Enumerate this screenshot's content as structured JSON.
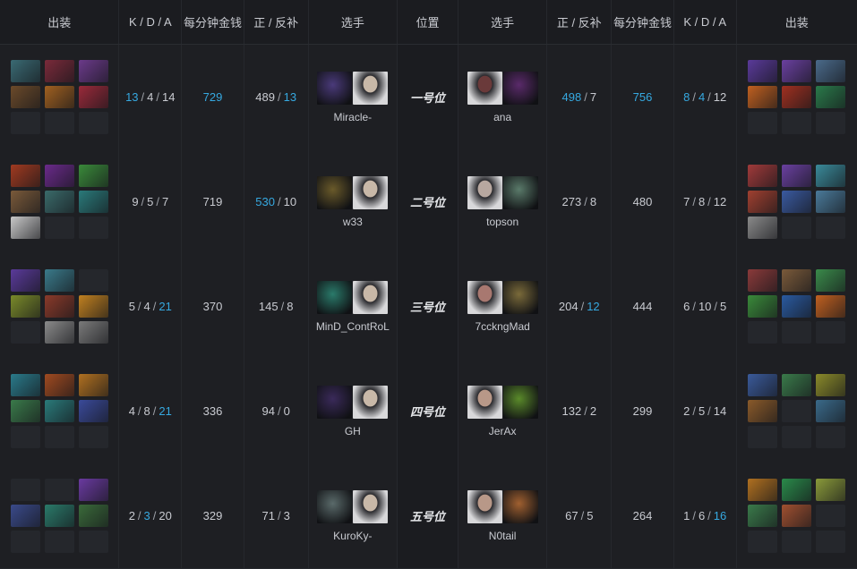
{
  "header": {
    "items_left": "出装",
    "kda_left": "K / D / A",
    "gpm_left": "每分钟金钱",
    "lh_left": "正 / 反补",
    "player_left": "选手",
    "position": "位置",
    "player_right": "选手",
    "lh_right": "正 / 反补",
    "gpm_right": "每分钟金钱",
    "kda_right": "K / D / A",
    "items_right": "出装"
  },
  "rows": [
    {
      "position": "一号位",
      "left": {
        "items": [
          "#3a6a73",
          "#7a2a3a",
          "#6b3a8a",
          "#6b4a2a",
          "#a06020",
          "#9a2a3a",
          "",
          "",
          ""
        ],
        "kills": "13",
        "deaths": "4",
        "assists": "14",
        "kills_hi": true,
        "deaths_hi": false,
        "assists_hi": false,
        "gpm": "729",
        "gpm_hi": true,
        "lh": "489",
        "dn": "13",
        "lh_hi": false,
        "dn_hi": true,
        "hero_color": "#4a3a7a",
        "photo_color": "#c8b8a8",
        "player": "Miracle-"
      },
      "right": {
        "items": [
          "#5a3a9a",
          "#6a40a0",
          "#4a6a8a",
          "#c06020",
          "#a03020",
          "#2a7a4a",
          "",
          "",
          ""
        ],
        "kills": "8",
        "deaths": "4",
        "assists": "12",
        "kills_hi": true,
        "deaths_hi": true,
        "assists_hi": false,
        "gpm": "756",
        "gpm_hi": true,
        "lh": "498",
        "dn": "7",
        "lh_hi": true,
        "dn_hi": false,
        "hero_color": "#5a2a6a",
        "photo_color": "#6a3a3a",
        "player": "ana"
      }
    },
    {
      "position": "二号位",
      "left": {
        "items": [
          "#a03a20",
          "#6a2a8a",
          "#3a8a3a",
          "#7a5a3a",
          "#3a6a6a",
          "#2a7a7a",
          "#c8c8c8",
          "",
          ""
        ],
        "kills": "9",
        "deaths": "5",
        "assists": "7",
        "kills_hi": false,
        "deaths_hi": false,
        "assists_hi": false,
        "gpm": "719",
        "gpm_hi": false,
        "lh": "530",
        "dn": "10",
        "lh_hi": true,
        "dn_hi": false,
        "hero_color": "#6a5a2a",
        "photo_color": "#c8b8a8",
        "player": "w33"
      },
      "right": {
        "items": [
          "#a03a3a",
          "#6a40a0",
          "#3a8a9a",
          "#a04030",
          "#3a5aa0",
          "#4a7a9a",
          "#8a8a8a",
          "",
          ""
        ],
        "kills": "7",
        "deaths": "8",
        "assists": "12",
        "kills_hi": false,
        "deaths_hi": false,
        "assists_hi": false,
        "gpm": "480",
        "gpm_hi": false,
        "lh": "273",
        "dn": "8",
        "lh_hi": false,
        "dn_hi": false,
        "hero_color": "#5a7a6a",
        "photo_color": "#b8a8a0",
        "player": "topson"
      }
    },
    {
      "position": "三号位",
      "left": {
        "items": [
          "#5a3a9a",
          "#3a7a8a",
          "",
          "#7a8a2a",
          "#8a3a2a",
          "#c08020",
          "",
          "#8a8a8a",
          "#7a7a7a"
        ],
        "kills": "5",
        "deaths": "4",
        "assists": "21",
        "kills_hi": false,
        "deaths_hi": false,
        "assists_hi": true,
        "gpm": "370",
        "gpm_hi": false,
        "lh": "145",
        "dn": "8",
        "lh_hi": false,
        "dn_hi": false,
        "hero_color": "#2a7a6a",
        "photo_color": "#c8b8a8",
        "player": "MinD_ContRoL"
      },
      "right": {
        "items": [
          "#8a3a3a",
          "#7a5a3a",
          "#3a8a4a",
          "#3a8a3a",
          "#2a5aa0",
          "#c06020",
          "",
          "",
          ""
        ],
        "kills": "6",
        "deaths": "10",
        "assists": "5",
        "kills_hi": false,
        "deaths_hi": false,
        "assists_hi": false,
        "gpm": "444",
        "gpm_hi": false,
        "lh": "204",
        "dn": "12",
        "lh_hi": false,
        "dn_hi": true,
        "hero_color": "#7a6a3a",
        "photo_color": "#a87870",
        "player": "7cckngMad"
      }
    },
    {
      "position": "四号位",
      "left": {
        "items": [
          "#2a7a8a",
          "#a04a20",
          "#b07020",
          "#3a7a4a",
          "#2a7a7a",
          "#3a4a9a",
          "",
          "",
          ""
        ],
        "kills": "4",
        "deaths": "8",
        "assists": "21",
        "kills_hi": false,
        "deaths_hi": false,
        "assists_hi": true,
        "gpm": "336",
        "gpm_hi": false,
        "lh": "94",
        "dn": "0",
        "lh_hi": false,
        "dn_hi": false,
        "hero_color": "#3a2a5a",
        "photo_color": "#c8b8a8",
        "player": "GH"
      },
      "right": {
        "items": [
          "#3a5a9a",
          "#3a7a4a",
          "#8a8a2a",
          "#8a5a2a",
          "",
          "#3a6a8a",
          "",
          "",
          ""
        ],
        "kills": "2",
        "deaths": "5",
        "assists": "14",
        "kills_hi": false,
        "deaths_hi": false,
        "assists_hi": false,
        "gpm": "299",
        "gpm_hi": false,
        "lh": "132",
        "dn": "2",
        "lh_hi": false,
        "dn_hi": false,
        "hero_color": "#5a8a2a",
        "photo_color": "#b89888",
        "player": "JerAx"
      }
    },
    {
      "position": "五号位",
      "left": {
        "items": [
          "",
          "",
          "#6a3aa0",
          "#3a4a8a",
          "#2a7a6a",
          "#3a6a3a",
          "",
          "",
          ""
        ],
        "kills": "2",
        "deaths": "3",
        "assists": "20",
        "kills_hi": false,
        "deaths_hi": true,
        "assists_hi": false,
        "gpm": "329",
        "gpm_hi": false,
        "lh": "71",
        "dn": "3",
        "lh_hi": false,
        "dn_hi": false,
        "hero_color": "#5a6a6a",
        "photo_color": "#c8b8a8",
        "player": "KuroKy-"
      },
      "right": {
        "items": [
          "#b07020",
          "#2a8a4a",
          "#8a9a3a",
          "#3a7a4a",
          "#a05030",
          "",
          "",
          "",
          ""
        ],
        "kills": "1",
        "deaths": "6",
        "assists": "16",
        "kills_hi": false,
        "deaths_hi": false,
        "assists_hi": true,
        "gpm": "264",
        "gpm_hi": false,
        "lh": "67",
        "dn": "5",
        "lh_hi": false,
        "dn_hi": false,
        "hero_color": "#a06030",
        "photo_color": "#b89888",
        "player": "N0tail"
      }
    }
  ]
}
